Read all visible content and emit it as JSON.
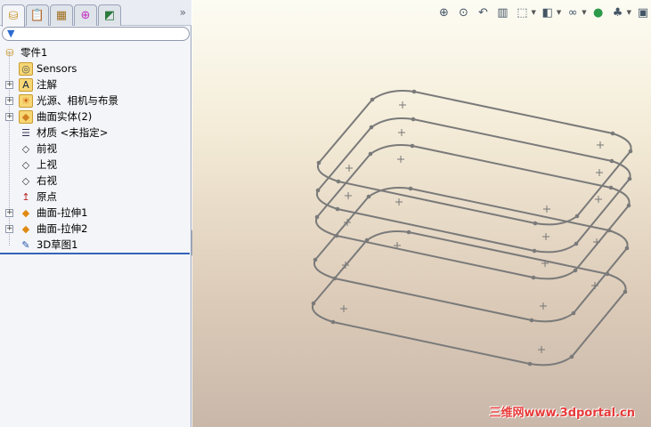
{
  "panel": {
    "tabs": [
      {
        "icon": "feature-manager-icon"
      },
      {
        "icon": "property-manager-icon"
      },
      {
        "icon": "configuration-manager-icon"
      },
      {
        "icon": "dimxpert-icon"
      },
      {
        "icon": "display-manager-icon"
      }
    ],
    "more": "»",
    "filter_icon": "filter-icon"
  },
  "tree": [
    {
      "label": "零件1",
      "icon": "part-icon",
      "expand": false,
      "level": 0
    },
    {
      "label": "Sensors",
      "icon": "sensors-folder-icon",
      "expand": false,
      "level": 1
    },
    {
      "label": "注解",
      "icon": "annotations-folder-icon",
      "expand": true,
      "level": 1
    },
    {
      "label": "光源、相机与布景",
      "icon": "lights-folder-icon",
      "expand": true,
      "level": 1
    },
    {
      "label": "曲面实体(2)",
      "icon": "surface-bodies-folder-icon",
      "expand": true,
      "level": 1
    },
    {
      "label": "材质 <未指定>",
      "icon": "material-icon",
      "expand": false,
      "level": 1
    },
    {
      "label": "前视",
      "icon": "plane-icon",
      "expand": false,
      "level": 1
    },
    {
      "label": "上视",
      "icon": "plane-icon",
      "expand": false,
      "level": 1
    },
    {
      "label": "右视",
      "icon": "plane-icon",
      "expand": false,
      "level": 1
    },
    {
      "label": "原点",
      "icon": "origin-icon",
      "expand": false,
      "level": 1
    },
    {
      "label": "曲面-拉伸1",
      "icon": "surface-extrude-icon",
      "expand": true,
      "level": 1
    },
    {
      "label": "曲面-拉伸2",
      "icon": "surface-extrude-icon",
      "expand": true,
      "level": 1
    },
    {
      "label": "3D草图1",
      "icon": "3d-sketch-icon",
      "expand": false,
      "level": 1
    }
  ],
  "toolbar": [
    "zoom-to-fit-icon",
    "zoom-to-area-icon",
    "previous-view-icon",
    "section-view-icon",
    "view-orientation-icon",
    "display-style-icon",
    "hide-show-items-icon",
    "edit-appearance-icon",
    "apply-scene-icon",
    "view-settings-icon"
  ],
  "watermark": "三维网www.3dportal.cn",
  "colors": {
    "sketch": "#7a7a7a",
    "accent": "#3563b8"
  }
}
